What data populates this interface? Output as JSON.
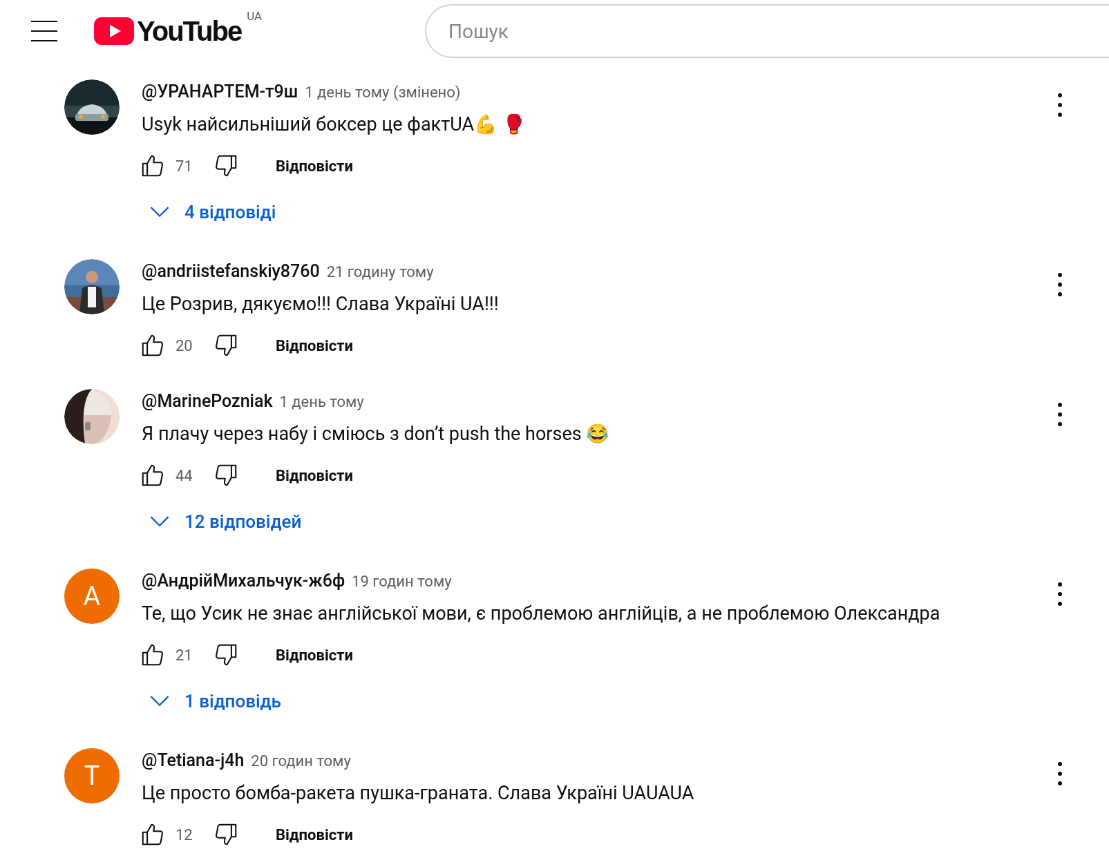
{
  "header": {
    "logo_text": "YouTube",
    "country": "UA",
    "search": {
      "placeholder": "Пошук"
    }
  },
  "comments": [
    {
      "author": "@УРАНАРТЕМ-т9ш",
      "time": "1 день тому (змінено)",
      "text": "Usyk найсильніший боксер це фактUA💪 🥊",
      "likes": "71",
      "reply_label": "Відповісти",
      "replies": "4 відповіді"
    },
    {
      "author": "@andriistefanskiy8760",
      "time": "21 годину тому",
      "text": "Це Розрив, дякуємо!!! Слава Україні UA!!!",
      "likes": "20",
      "reply_label": "Відповісти"
    },
    {
      "author": "@MarinePozniak",
      "time": "1 день тому",
      "text": "Я плачу через набу і сміюсь з don’t push the horses 😂",
      "likes": "44",
      "reply_label": "Відповісти",
      "replies": "12 відповідей"
    },
    {
      "author": "@АндрійМихальчук-ж6ф",
      "time": "19 годин тому",
      "text": "Те, що Усик не знає англійської мови, є проблемою англійців, а не проблемою Олександра",
      "likes": "21",
      "reply_label": "Відповісти",
      "replies": "1 відповідь",
      "avatar": {
        "kind": "letter",
        "letter": "A",
        "color": "#ef6c00"
      }
    },
    {
      "author": "@Tetiana-j4h",
      "time": "20 годин тому",
      "text": "Це просто бомба-ракета пушка-граната. Слава Україні UAUAUA",
      "likes": "12",
      "reply_label": "Відповісти",
      "avatar": {
        "kind": "letter",
        "letter": "T",
        "color": "#ef6c00"
      }
    }
  ]
}
